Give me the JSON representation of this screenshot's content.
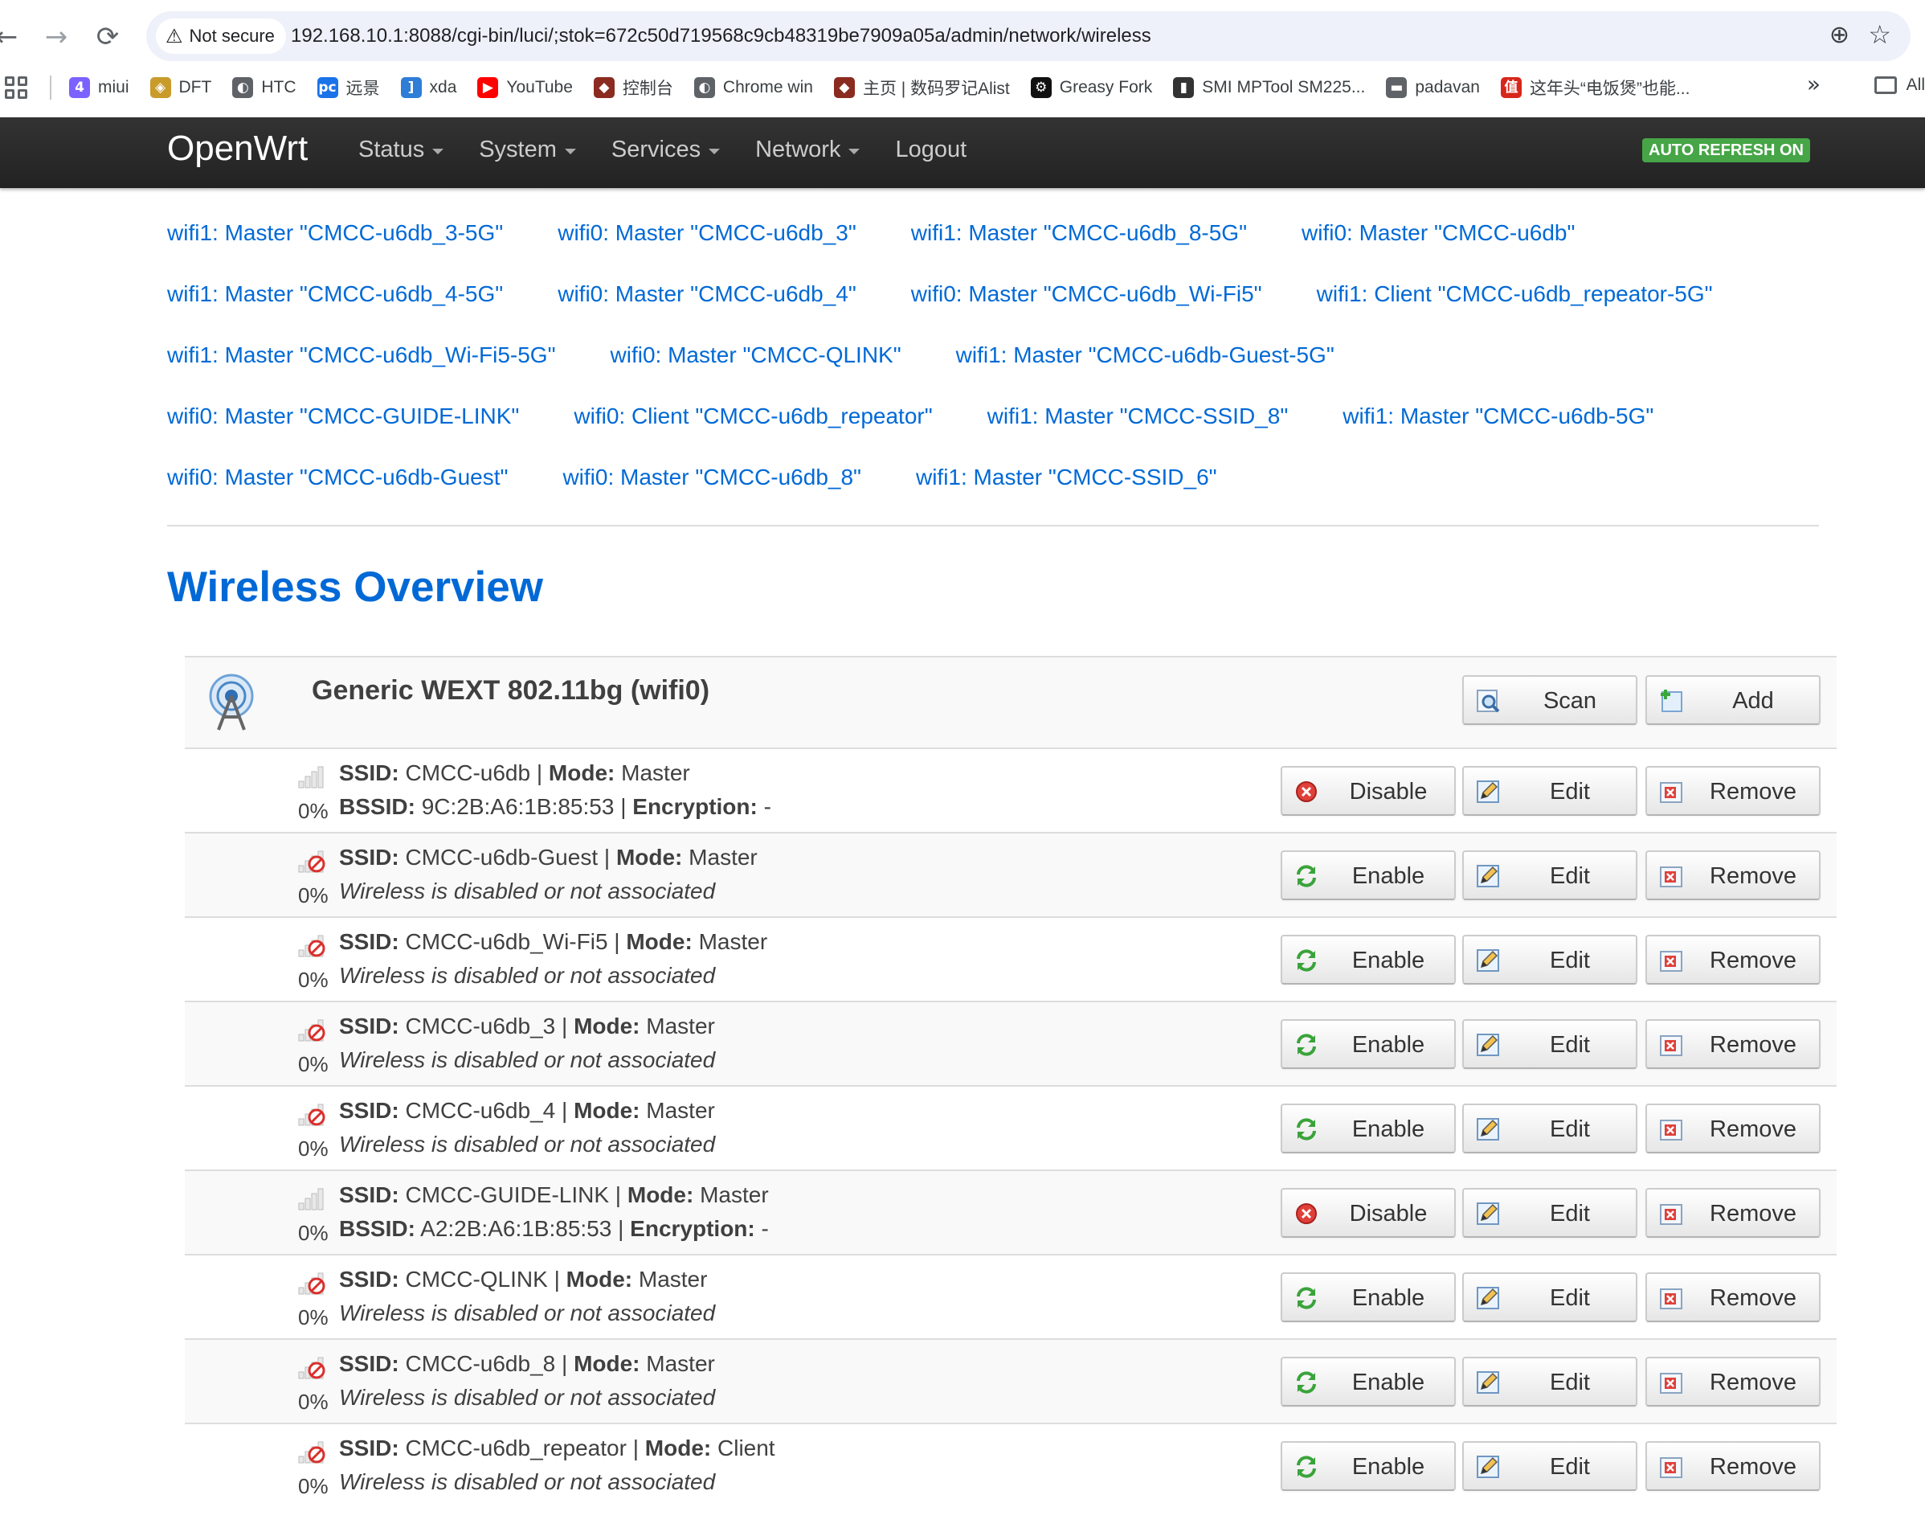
{
  "browser": {
    "back": "←",
    "forward": "→",
    "reload": "⟳",
    "security": "Not secure",
    "url": "192.168.10.1:8088/cgi-bin/luci/;stok=672c50d719568c9cb48319be7909a05a/admin/network/wireless",
    "bookmarks": [
      {
        "label": "miui",
        "icon": "miui-icon",
        "color": "#7b61ff",
        "glyph": "4"
      },
      {
        "label": "DFT",
        "icon": "dft-icon",
        "color": "#c89b2a",
        "glyph": "◈"
      },
      {
        "label": "HTC",
        "icon": "globe-icon",
        "color": "#5f6368",
        "glyph": "◐"
      },
      {
        "label": "远景",
        "icon": "pc-icon",
        "color": "#1a73e8",
        "glyph": "pc"
      },
      {
        "label": "xda",
        "icon": "xda-icon",
        "color": "#2e7dd7",
        "glyph": "]"
      },
      {
        "label": "YouTube",
        "icon": "youtube-icon",
        "color": "#ff0000",
        "glyph": "▶"
      },
      {
        "label": "控制台",
        "icon": "avatar-icon",
        "color": "#8b2b1f",
        "glyph": "◆"
      },
      {
        "label": "Chrome win",
        "icon": "globe-icon",
        "color": "#5f6368",
        "glyph": "◐"
      },
      {
        "label": "主页 | 数码罗记Alist",
        "icon": "avatar-icon",
        "color": "#8b2b1f",
        "glyph": "◆"
      },
      {
        "label": "Greasy Fork",
        "icon": "greasyfork-icon",
        "color": "#111111",
        "glyph": "⚙"
      },
      {
        "label": "SMI MPTool SM225...",
        "icon": "usb-icon",
        "color": "#333333",
        "glyph": "▮"
      },
      {
        "label": "padavan",
        "icon": "folder-icon",
        "color": "#5f6368",
        "glyph": "▬"
      },
      {
        "label": "这年头“电饭煲”也能...",
        "icon": "zhihu-icon",
        "color": "#d7261b",
        "glyph": "值"
      }
    ],
    "more": "»",
    "all_bookmarks": "All"
  },
  "header": {
    "brand": "OpenWrt",
    "menu": [
      {
        "label": "Status",
        "dropdown": true
      },
      {
        "label": "System",
        "dropdown": true
      },
      {
        "label": "Services",
        "dropdown": true
      },
      {
        "label": "Network",
        "dropdown": true
      },
      {
        "label": "Logout",
        "dropdown": false
      }
    ],
    "auto_refresh": "AUTO REFRESH ON"
  },
  "tabs": [
    [
      "wifi1: Master \"CMCC-u6db_3-5G\"",
      "wifi0: Master \"CMCC-u6db_3\"",
      "wifi1: Master \"CMCC-u6db_8-5G\"",
      "wifi0: Master \"CMCC-u6db\""
    ],
    [
      "wifi1: Master \"CMCC-u6db_4-5G\"",
      "wifi0: Master \"CMCC-u6db_4\"",
      "wifi0: Master \"CMCC-u6db_Wi-Fi5\"",
      "wifi1: Client \"CMCC-u6db_repeator-5G\""
    ],
    [
      "wifi1: Master \"CMCC-u6db_Wi-Fi5-5G\"",
      "wifi0: Master \"CMCC-QLINK\"",
      "wifi1: Master \"CMCC-u6db-Guest-5G\""
    ],
    [
      "wifi0: Master \"CMCC-GUIDE-LINK\"",
      "wifi0: Client \"CMCC-u6db_repeator\"",
      "wifi1: Master \"CMCC-SSID_8\"",
      "wifi1: Master \"CMCC-u6db-5G\""
    ],
    [
      "wifi0: Master \"CMCC-u6db-Guest\"",
      "wifi0: Master \"CMCC-u6db_8\"",
      "wifi1: Master \"CMCC-SSID_6\""
    ]
  ],
  "page_title": "Wireless Overview",
  "device": {
    "name": "Generic WEXT 802.11bg (wifi0)",
    "scan_label": "Scan",
    "add_label": "Add"
  },
  "labels": {
    "ssid": "SSID:",
    "mode": "Mode:",
    "bssid": "BSSID:",
    "encryption": "Encryption:",
    "sep": " | ",
    "disabled_text": "Wireless is disabled or not associated",
    "enable": "Enable",
    "disable": "Disable",
    "edit": "Edit",
    "remove": "Remove"
  },
  "networks": [
    {
      "ssid": "CMCC-u6db",
      "mode": "Master",
      "signal": "0%",
      "enabled": true,
      "bssid": "9C:2B:A6:1B:85:53",
      "encryption": "-"
    },
    {
      "ssid": "CMCC-u6db-Guest",
      "mode": "Master",
      "signal": "0%",
      "enabled": false
    },
    {
      "ssid": "CMCC-u6db_Wi-Fi5",
      "mode": "Master",
      "signal": "0%",
      "enabled": false
    },
    {
      "ssid": "CMCC-u6db_3",
      "mode": "Master",
      "signal": "0%",
      "enabled": false
    },
    {
      "ssid": "CMCC-u6db_4",
      "mode": "Master",
      "signal": "0%",
      "enabled": false
    },
    {
      "ssid": "CMCC-GUIDE-LINK",
      "mode": "Master",
      "signal": "0%",
      "enabled": true,
      "bssid": "A2:2B:A6:1B:85:53",
      "encryption": "-"
    },
    {
      "ssid": "CMCC-QLINK",
      "mode": "Master",
      "signal": "0%",
      "enabled": false
    },
    {
      "ssid": "CMCC-u6db_8",
      "mode": "Master",
      "signal": "0%",
      "enabled": false
    },
    {
      "ssid": "CMCC-u6db_repeator",
      "mode": "Client",
      "signal": "0%",
      "enabled": false
    }
  ]
}
